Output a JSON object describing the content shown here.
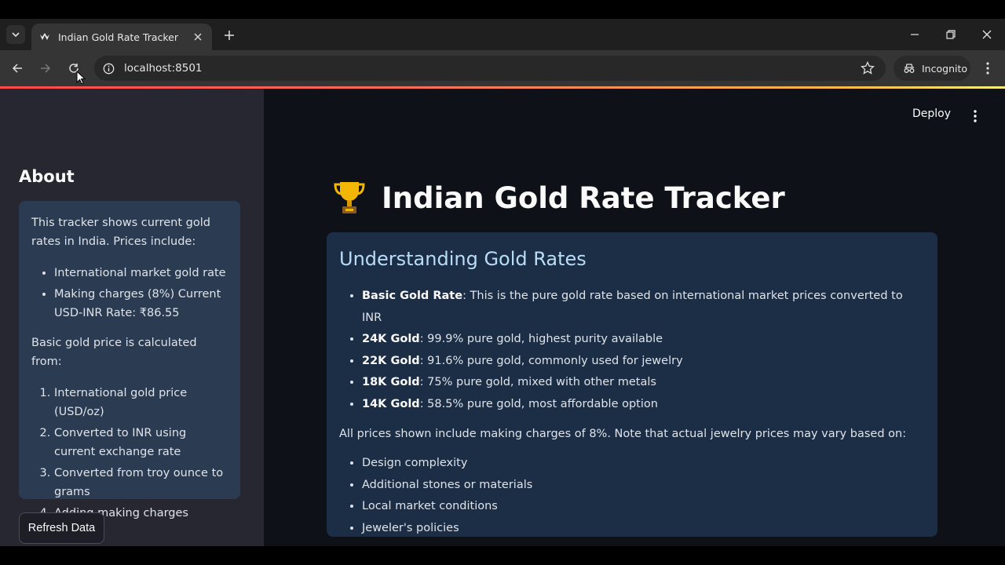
{
  "browser": {
    "tab_title": "Indian Gold Rate Tracker",
    "url": "localhost:8501",
    "incognito_label": "Incognito",
    "icons": [
      "tab-search-icon",
      "close-icon",
      "plus-icon",
      "minimize-icon",
      "restore-icon",
      "close-window-icon",
      "back-icon",
      "forward-icon",
      "reload-icon",
      "info-icon",
      "star-icon",
      "incognito-icon",
      "kebab-menu-icon"
    ]
  },
  "app_header": {
    "deploy_label": "Deploy"
  },
  "sidebar": {
    "title": "About",
    "intro": "This tracker shows current gold rates in India. Prices include:",
    "bullets": [
      "International market gold rate",
      "Making charges (8%) Current USD-INR Rate: ₹86.55"
    ],
    "calc_intro": "Basic gold price is calculated from:",
    "steps": [
      "International gold price (USD/oz)",
      "Converted to INR using current exchange rate",
      "Converted from troy ounce to grams",
      "Adding making charges"
    ],
    "refresh_label": "Refresh Data"
  },
  "main": {
    "title": "Indian Gold Rate Tracker",
    "title_icon": "trophy-icon",
    "section_heading": "Understanding Gold Rates",
    "definitions": [
      {
        "term": "Basic Gold Rate",
        "text": ": This is the pure gold rate based on international market prices converted to INR"
      },
      {
        "term": "24K Gold",
        "text": ": 99.9% pure gold, highest purity available"
      },
      {
        "term": "22K Gold",
        "text": ": 91.6% pure gold, commonly used for jewelry"
      },
      {
        "term": "18K Gold",
        "text": ": 75% pure gold, mixed with other metals"
      },
      {
        "term": "14K Gold",
        "text": ": 58.5% pure gold, most affordable option"
      }
    ],
    "note": "All prices shown include making charges of 8%. Note that actual jewelry prices may vary based on:",
    "factors": [
      "Design complexity",
      "Additional stones or materials",
      "Local market conditions",
      "Jeweler's policies"
    ]
  },
  "colors": {
    "accent_gradient_start": "#ff4b4b",
    "accent_gradient_end": "#fff176",
    "sidebar_bg": "#262730",
    "main_bg": "#0e1117",
    "info_box_bg": "#1c2e46",
    "heading_blue": "#b9dcf7"
  }
}
